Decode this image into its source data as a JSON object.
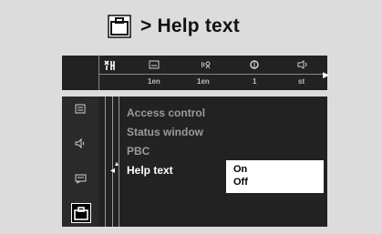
{
  "header": {
    "title": "> Help text",
    "icon": "briefcase-icon"
  },
  "topbar": {
    "items": [
      {
        "icon": "settings-icon",
        "label": ""
      },
      {
        "icon": "subtitle-icon",
        "label": "1en"
      },
      {
        "icon": "audio-language-icon",
        "label": "1en"
      },
      {
        "icon": "angle-icon",
        "label": "1"
      },
      {
        "icon": "sound-icon",
        "label": "st"
      }
    ]
  },
  "sidebar": {
    "icons": [
      "display-icon",
      "speaker-icon",
      "chat-icon",
      "briefcase-icon"
    ]
  },
  "menu": {
    "items": [
      "Access control",
      "Status window",
      "PBC",
      "Help text"
    ]
  },
  "popup": {
    "options": [
      "On",
      "Off"
    ]
  },
  "colors": {
    "background": "#dcdcdc",
    "panel": "#222222",
    "text_dim": "#9a9a9a",
    "text_active": "#ffffff"
  }
}
